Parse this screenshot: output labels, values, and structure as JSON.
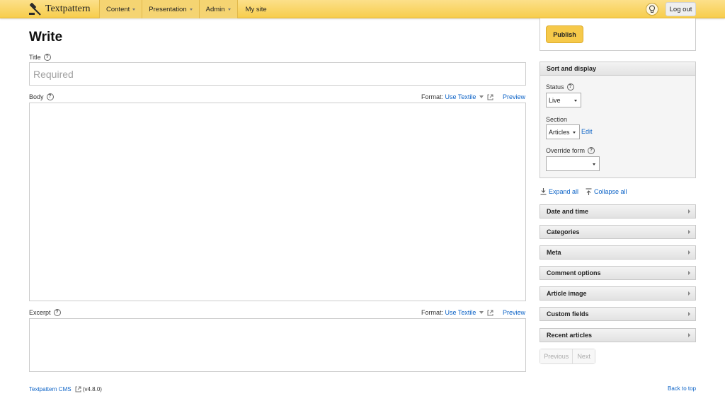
{
  "topbar": {
    "brand": "Textpattern",
    "nav": [
      {
        "label": "Content",
        "dropdown": true
      },
      {
        "label": "Presentation",
        "dropdown": true
      },
      {
        "label": "Admin",
        "dropdown": true
      },
      {
        "label": "My site",
        "dropdown": false
      }
    ],
    "logout_label": "Log out",
    "colors": {
      "bar": "#f7cd4c",
      "accent": "#f6c94a",
      "link": "#0c63c7"
    }
  },
  "main": {
    "title": "Write",
    "title_field": {
      "label": "Title",
      "placeholder": "Required",
      "value": ""
    },
    "body_field": {
      "label": "Body",
      "format_label": "Format:",
      "format_value": "Use Textile",
      "preview": "Preview"
    },
    "excerpt_field": {
      "label": "Excerpt",
      "format_label": "Format:",
      "format_value": "Use Textile",
      "preview": "Preview"
    }
  },
  "sidebar": {
    "publish_label": "Publish",
    "sort_display": {
      "heading": "Sort and display",
      "status_label": "Status",
      "status_value": "Live",
      "section_label": "Section",
      "section_value": "Articles",
      "section_edit": "Edit",
      "override_label": "Override form",
      "override_value": ""
    },
    "expand_all": "Expand all",
    "collapse_all": "Collapse all",
    "panels": [
      "Date and time",
      "Categories",
      "Meta",
      "Comment options",
      "Article image",
      "Custom fields",
      "Recent articles"
    ],
    "pager": {
      "previous": "Previous",
      "next": "Next"
    }
  },
  "footer": {
    "cms_link": "Textpattern CMS",
    "version": "(v4.8.0)",
    "back_to_top": "Back to top"
  }
}
